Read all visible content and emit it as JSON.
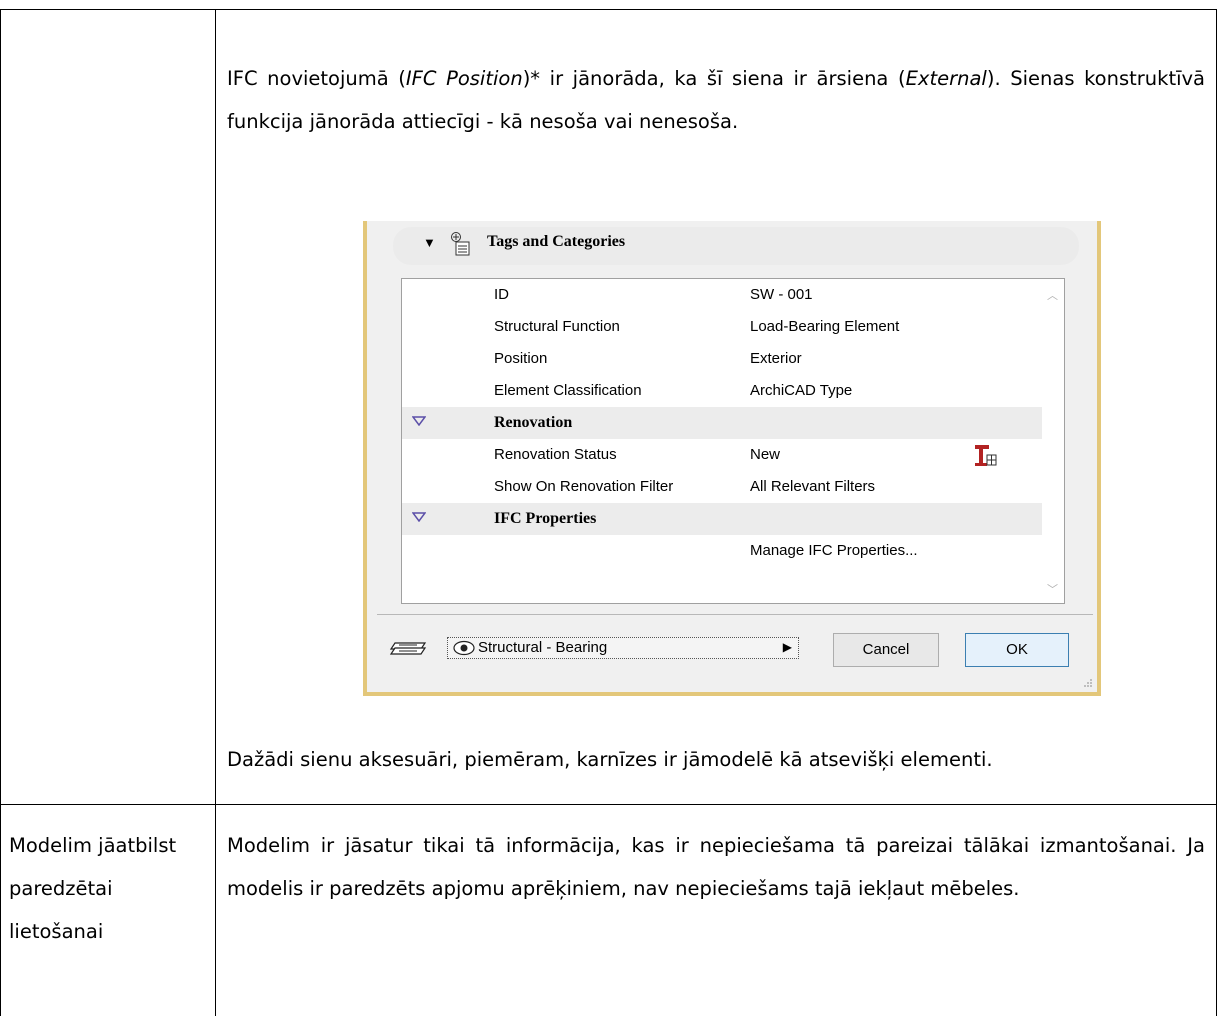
{
  "paragraph1": {
    "a": "IFC novietojumā (",
    "b": "IFC Position",
    "c": ")* ir jānorāda, ka šī siena ir ārsiena (",
    "d": "External",
    "e": "). Sienas konstruktīvā funkcija jānorāda attiecīgi - kā nesoša vai nenesoša."
  },
  "dialog": {
    "header_title": "Tags and Categories",
    "rows": [
      {
        "label": "ID",
        "value": "SW - 001"
      },
      {
        "label": "Structural Function",
        "value": "Load-Bearing Element"
      },
      {
        "label": "Position",
        "value": "Exterior"
      },
      {
        "label": "Element Classification",
        "value": "ArchiCAD Type"
      }
    ],
    "renovation_group": "Renovation",
    "renovation_rows": [
      {
        "label": "Renovation Status",
        "value": "New"
      },
      {
        "label": "Show On Renovation Filter",
        "value": "All Relevant Filters"
      }
    ],
    "ifc_group": "IFC Properties",
    "ifc_manage": "Manage IFC Properties...",
    "favorite_label": "Structural - Bearing",
    "cancel_label": "Cancel",
    "ok_label": "OK",
    "colors": {
      "frame": "#e3c77a",
      "group_tri": "#5b4fa8",
      "reno_icon": "#b22222"
    }
  },
  "paragraph2": "Dažādi sienu aksesuāri, piemēram, karnīzes ir jāmodelē kā atsevišķi elementi.",
  "requirement_label": "Modelim jāatbilst paredzētai lietošanai",
  "requirement_text": "Modelim ir jāsatur tikai tā informācija, kas ir nepieciešama tā pareizai tālākai izmantošanai. Ja modelis ir paredzēts apjomu aprēķiniem, nav nepieciešams tajā iekļaut mēbeles."
}
